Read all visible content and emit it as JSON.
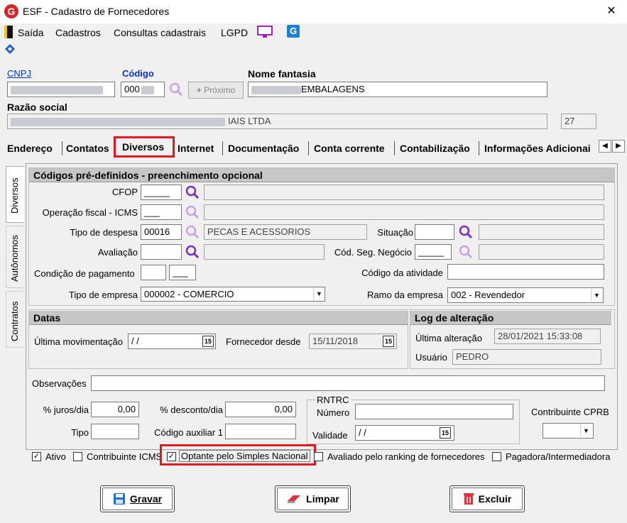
{
  "window": {
    "title": "ESF - Cadastro de Fornecedores",
    "close_glyph": "✕"
  },
  "menu": {
    "items": [
      "Saída",
      "Cadastros",
      "Consultas cadastrais",
      "LGPD"
    ]
  },
  "header": {
    "cnpj_label": "CNPJ",
    "cnpj_value": "",
    "codigo_label": "Código",
    "codigo_value": "000",
    "proximo_label": "Próximo",
    "nome_fantasia_label": "Nome fantasia",
    "nome_fantasia_value": "EMBALAGENS",
    "razao_social_label": "Razão social",
    "razao_social_value": "IAIS LTDA",
    "razao_extra_value": "27"
  },
  "tabs": [
    "Endereço",
    "Contatos",
    "Diversos",
    "Internet",
    "Documentação",
    "Conta corrente",
    "Contabilização",
    "Informações Adicionai"
  ],
  "side_tabs": [
    "Diversos",
    "Autônomos",
    "Contratos"
  ],
  "codigos": {
    "section_title": "Códigos pré-definidos - preenchimento opcional",
    "cfop_label": "CFOP",
    "cfop_value": "_____",
    "operacao_label": "Operação fiscal - ICMS",
    "operacao_value": "___",
    "tipo_despesa_label": "Tipo de despesa",
    "tipo_despesa_value": "00016",
    "tipo_despesa_desc": "PECAS E ACESSORIOS",
    "situacao_label": "Situação",
    "situacao_value": "",
    "avaliacao_label": "Avaliação",
    "avaliacao_value": "",
    "cod_seg_label": "Cód. Seg. Negócio",
    "cod_seg_value": "_____",
    "condicao_label": "Condição de pagamento",
    "condicao_value2": "___",
    "codigo_atividade_label": "Código da atividade",
    "codigo_atividade_value": "",
    "tipo_empresa_label": "Tipo de empresa",
    "tipo_empresa_value": "000002 - COMERCIO",
    "ramo_label": "Ramo da empresa",
    "ramo_value": "002 - Revendedor"
  },
  "datas": {
    "section_title": "Datas",
    "ultima_mov_label": "Última movimentação",
    "ultima_mov_value": " /  /",
    "fornecedor_desde_label": "Fornecedor desde",
    "fornecedor_desde_value": "15/11/2018",
    "cal_glyph": "15"
  },
  "log": {
    "section_title": "Log de alteração",
    "ultima_alt_label": "Última alteração",
    "ultima_alt_value": "28/01/2021 15:33:08",
    "usuario_label": "Usuário",
    "usuario_value": "PEDRO"
  },
  "observacoes_label": "Observações",
  "financeiro": {
    "juros_label": "% juros/dia",
    "juros_value": "0,00",
    "desconto_label": "% desconto/dia",
    "desconto_value": "0,00",
    "tipo_label": "Tipo",
    "tipo_value": "",
    "cod_aux_label": "Código auxiliar 1",
    "cod_aux_value": ""
  },
  "rntrc": {
    "title": "RNTRC",
    "numero_label": "Número",
    "validade_label": "Validade",
    "validade_value": " /  /"
  },
  "cprb_label": "Contribuinte CPRB",
  "checks": {
    "ativo": "Ativo",
    "contribuinte_icms": "Contribuinte ICMS",
    "optante": "Optante pelo Simples Nacional",
    "avaliado": "Avaliado pelo ranking de fornecedores",
    "pagadora": "Pagadora/Intermediadora",
    "check_glyph": "✓"
  },
  "buttons": {
    "gravar": "Gravar",
    "limpar": "Limpar",
    "excluir": "Excluir"
  },
  "colors": {
    "highlight": "#e0171f",
    "section_header": "#c6c6c6",
    "lookup_icon": "#7a2fc0"
  }
}
